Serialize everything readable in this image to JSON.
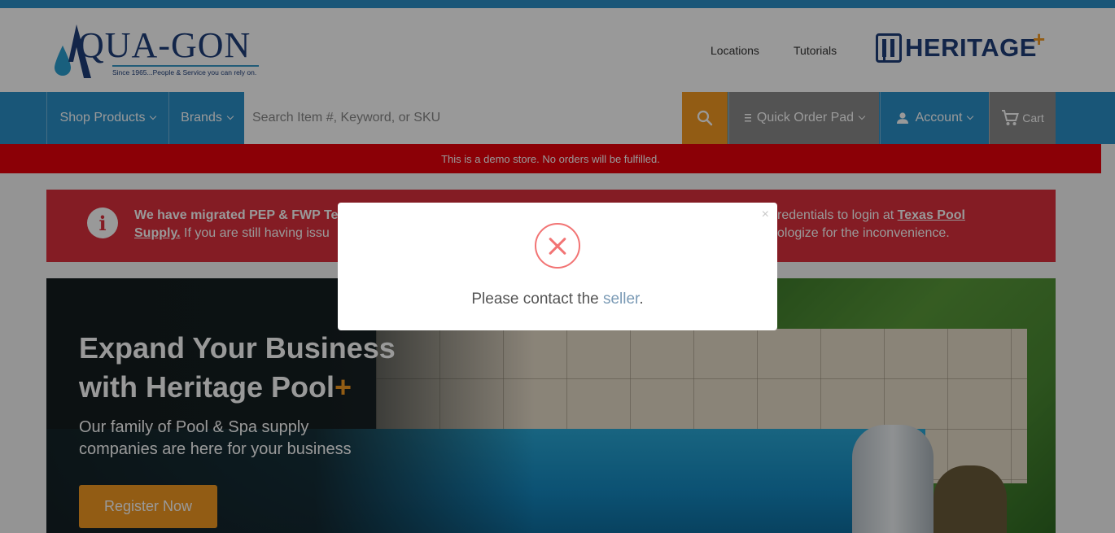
{
  "brand": {
    "logo_text": "QUA-GON",
    "tagline": "Since 1965...People & Service you can rely on.",
    "partner_logo_text": "HERITAGE",
    "partner_logo_plus": "+"
  },
  "header": {
    "links": [
      {
        "label": "Locations"
      },
      {
        "label": "Tutorials"
      }
    ]
  },
  "nav": {
    "shop_products": "Shop Products",
    "brands": "Brands",
    "search_placeholder": "Search Item #, Keyword, or SKU",
    "quick_order_pad": "Quick Order Pad",
    "account": "Account",
    "cart": "Cart"
  },
  "demo_notice": "This is a demo store. No orders will be fulfilled.",
  "alert": {
    "visible_left_bold": "We have migrated PEP & FWP Te",
    "visible_left_link_tail": "Supply.",
    "visible_left_rest": " If you are still having issu",
    "visible_right_line1": "redentials to login at ",
    "visible_right_link": "Texas Pool",
    "visible_right_line2": "ologize for the inconvenience."
  },
  "hero": {
    "title_line1": "Expand Your Business",
    "title_line2": "with Heritage Pool",
    "title_plus": "+",
    "subtitle": "Our family of Pool & Spa supply\ncompanies  are here for your business",
    "cta": "Register Now"
  },
  "modal": {
    "close": "×",
    "message_before": "Please contact the ",
    "message_link": "seller",
    "message_after": "."
  },
  "colors": {
    "primary_blue": "#2a8fc8",
    "accent_orange": "#f39a22",
    "demo_red": "#e8000b",
    "alert_red": "#dc2f3c",
    "error_icon": "#f27474"
  }
}
